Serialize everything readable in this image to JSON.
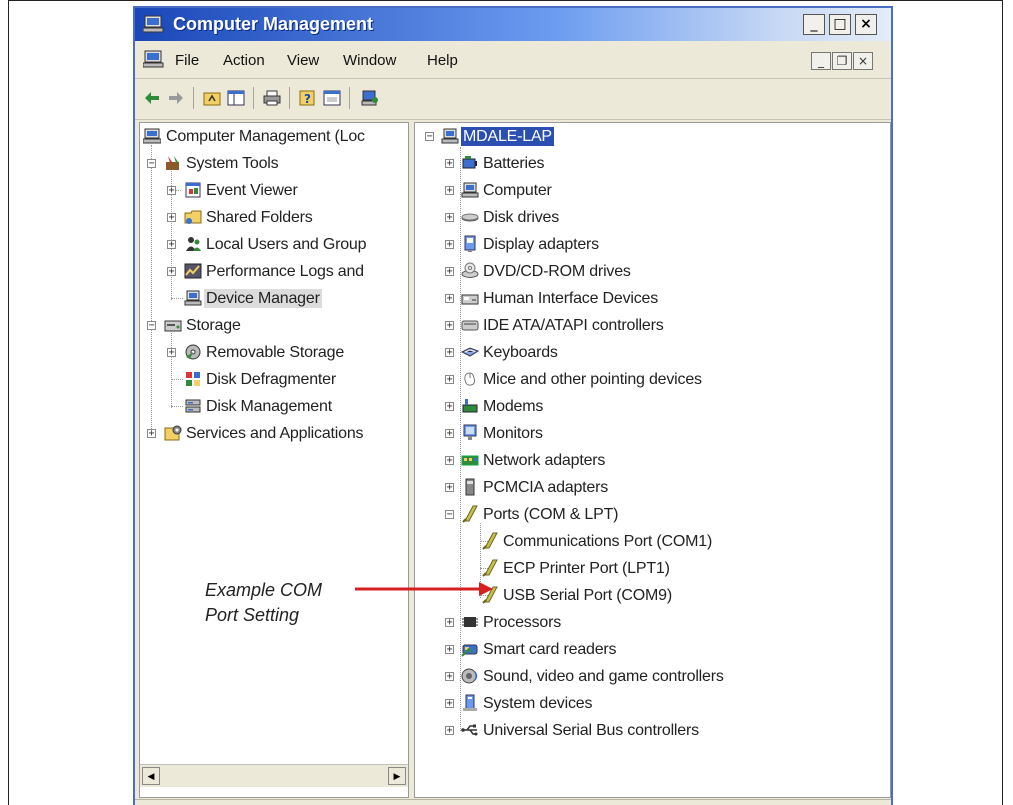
{
  "window": {
    "title": "Computer Management"
  },
  "title_buttons": {
    "minimize": "_",
    "maximize": "□",
    "close": "×"
  },
  "mdi_buttons": {
    "minimize": "_",
    "restore": "❐",
    "close": "×"
  },
  "menu": {
    "items": [
      "File",
      "Action",
      "View",
      "Window",
      "Help"
    ]
  },
  "left_tree": [
    {
      "label": "Computer Management (Loc",
      "icon": "computer-management-icon"
    },
    {
      "label": "System Tools",
      "icon": "system-tools-icon"
    },
    {
      "label": "Event Viewer",
      "icon": "event-viewer-icon"
    },
    {
      "label": "Shared Folders",
      "icon": "shared-folders-icon"
    },
    {
      "label": "Local Users and Group",
      "icon": "local-users-icon"
    },
    {
      "label": "Performance Logs and",
      "icon": "performance-logs-icon"
    },
    {
      "label": "Device Manager",
      "icon": "device-manager-icon",
      "selected": true
    },
    {
      "label": "Storage",
      "icon": "storage-icon"
    },
    {
      "label": "Removable Storage",
      "icon": "removable-storage-icon"
    },
    {
      "label": "Disk Defragmenter",
      "icon": "disk-defragmenter-icon"
    },
    {
      "label": "Disk Management",
      "icon": "disk-management-icon"
    },
    {
      "label": "Services and Applications",
      "icon": "services-icon"
    }
  ],
  "right_tree": [
    {
      "label": "MDALE-LAP",
      "icon": "computer-icon",
      "selected": true
    },
    {
      "label": "Batteries",
      "icon": "battery-icon"
    },
    {
      "label": "Computer",
      "icon": "computer-icon"
    },
    {
      "label": "Disk drives",
      "icon": "disk-drive-icon"
    },
    {
      "label": "Display adapters",
      "icon": "display-adapter-icon"
    },
    {
      "label": "DVD/CD-ROM drives",
      "icon": "dvd-drive-icon"
    },
    {
      "label": "Human Interface Devices",
      "icon": "hid-icon"
    },
    {
      "label": "IDE ATA/ATAPI controllers",
      "icon": "ide-controller-icon"
    },
    {
      "label": "Keyboards",
      "icon": "keyboard-icon"
    },
    {
      "label": "Mice and other pointing devices",
      "icon": "mouse-icon"
    },
    {
      "label": "Modems",
      "icon": "modem-icon"
    },
    {
      "label": "Monitors",
      "icon": "monitor-icon"
    },
    {
      "label": "Network adapters",
      "icon": "network-adapter-icon"
    },
    {
      "label": "PCMCIA adapters",
      "icon": "pcmcia-icon"
    },
    {
      "label": "Ports (COM & LPT)",
      "icon": "port-icon"
    },
    {
      "label": "Communications Port (COM1)",
      "icon": "port-icon"
    },
    {
      "label": "ECP Printer Port (LPT1)",
      "icon": "port-icon"
    },
    {
      "label": "USB Serial Port (COM9)",
      "icon": "port-icon"
    },
    {
      "label": "Processors",
      "icon": "processor-icon"
    },
    {
      "label": "Smart card readers",
      "icon": "smart-card-icon"
    },
    {
      "label": "Sound, video and game controllers",
      "icon": "sound-icon"
    },
    {
      "label": "System devices",
      "icon": "system-device-icon"
    },
    {
      "label": "Universal Serial Bus controllers",
      "icon": "usb-icon"
    }
  ],
  "scrollbar": {
    "left_arrow": "◀",
    "right_arrow": "▶"
  },
  "annotation": {
    "line1": "Example COM",
    "line2": "Port Setting",
    "color": "#d62020"
  },
  "colors": {
    "title_bar": "#1a47b8",
    "selection": "#2a4fb0",
    "frame": "#ece9d8"
  }
}
